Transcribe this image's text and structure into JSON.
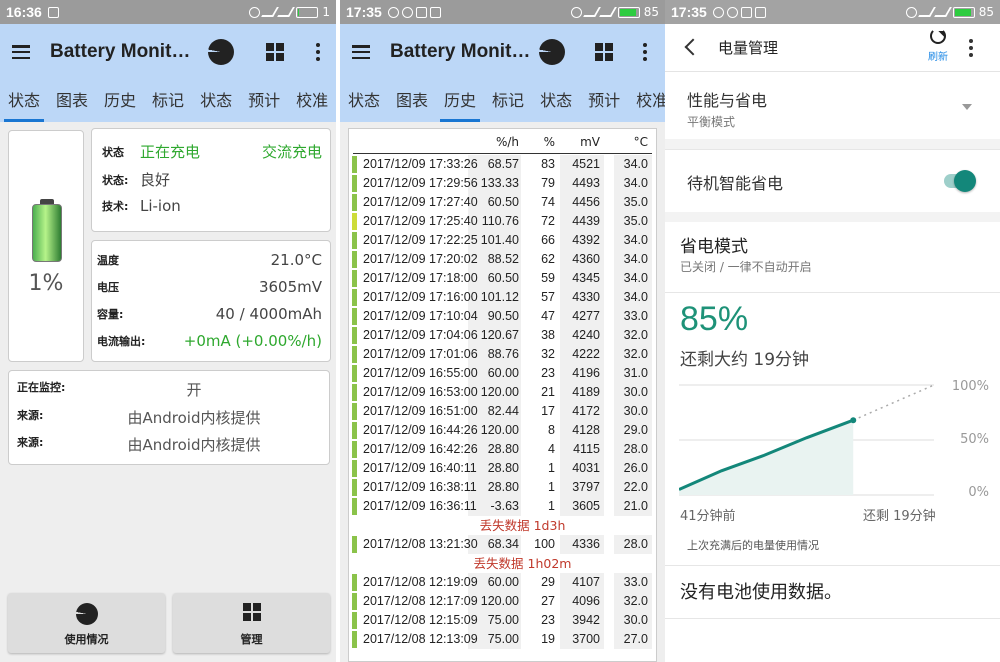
{
  "screen1": {
    "statusbar": {
      "time": "16:36",
      "battery_pct": "1"
    },
    "app_title": "Battery Monit…",
    "tabs": [
      "状态",
      "图表",
      "历史",
      "标记",
      "状态",
      "预计",
      "校准"
    ],
    "battery_pct": "1%",
    "status_card": {
      "status_label": "状态",
      "status_value": "正在充电",
      "charge_type": "交流充电",
      "health_label": "状态:",
      "health_value": "良好",
      "tech_label": "技术:",
      "tech_value": "Li-ion"
    },
    "detail_card": {
      "temp_label": "温度",
      "temp_value": "21.0°C",
      "voltage_label": "电压",
      "voltage_value": "3605mV",
      "capacity_label": "容量:",
      "capacity_value": "40 / 4000mAh",
      "current_label": "电流输出:",
      "current_value": "+0mA (+0.00%/h)"
    },
    "monitor_card": {
      "monitoring_label": "正在监控:",
      "monitoring_value": "开",
      "source1_label": "来源:",
      "source1_value": "由Android内核提供",
      "source2_label": "来源:",
      "source2_value": "由Android内核提供"
    },
    "buttons": {
      "usage": "使用情况",
      "manage": "管理"
    }
  },
  "screen2": {
    "statusbar": {
      "time": "17:35",
      "battery_pct": "85"
    },
    "app_title": "Battery Monit…",
    "tabs": [
      "状态",
      "图表",
      "历史",
      "标记",
      "状态",
      "预计",
      "校准"
    ],
    "headers": [
      "%/h",
      "%",
      "mV",
      "°C"
    ],
    "rows_a": [
      {
        "date": "2017/12/09 17:33:26",
        "rate": "68.57",
        "pct": "83",
        "mv": "4521",
        "temp": "34.0",
        "bar": "#8bc34a"
      },
      {
        "date": "2017/12/09 17:29:56",
        "rate": "133.33",
        "pct": "79",
        "mv": "4493",
        "temp": "34.0",
        "bar": "#8bc34a"
      },
      {
        "date": "2017/12/09 17:27:40",
        "rate": "60.50",
        "pct": "74",
        "mv": "4456",
        "temp": "35.0",
        "bar": "#8bc34a"
      },
      {
        "date": "2017/12/09 17:25:40",
        "rate": "110.76",
        "pct": "72",
        "mv": "4439",
        "temp": "35.0",
        "bar": "#cddc39"
      },
      {
        "date": "2017/12/09 17:22:25",
        "rate": "101.40",
        "pct": "66",
        "mv": "4392",
        "temp": "34.0",
        "bar": "#8bc34a"
      },
      {
        "date": "2017/12/09 17:20:02",
        "rate": "88.52",
        "pct": "62",
        "mv": "4360",
        "temp": "34.0",
        "bar": "#8bc34a"
      },
      {
        "date": "2017/12/09 17:18:00",
        "rate": "60.50",
        "pct": "59",
        "mv": "4345",
        "temp": "34.0",
        "bar": "#8bc34a"
      },
      {
        "date": "2017/12/09 17:16:00",
        "rate": "101.12",
        "pct": "57",
        "mv": "4330",
        "temp": "34.0",
        "bar": "#8bc34a"
      },
      {
        "date": "2017/12/09 17:10:04",
        "rate": "90.50",
        "pct": "47",
        "mv": "4277",
        "temp": "33.0",
        "bar": "#8bc34a"
      },
      {
        "date": "2017/12/09 17:04:06",
        "rate": "120.67",
        "pct": "38",
        "mv": "4240",
        "temp": "32.0",
        "bar": "#8bc34a"
      },
      {
        "date": "2017/12/09 17:01:06",
        "rate": "88.76",
        "pct": "32",
        "mv": "4222",
        "temp": "32.0",
        "bar": "#8bc34a"
      },
      {
        "date": "2017/12/09 16:55:00",
        "rate": "60.00",
        "pct": "23",
        "mv": "4196",
        "temp": "31.0",
        "bar": "#8bc34a"
      },
      {
        "date": "2017/12/09 16:53:00",
        "rate": "120.00",
        "pct": "21",
        "mv": "4189",
        "temp": "30.0",
        "bar": "#8bc34a"
      },
      {
        "date": "2017/12/09 16:51:00",
        "rate": "82.44",
        "pct": "17",
        "mv": "4172",
        "temp": "30.0",
        "bar": "#8bc34a"
      },
      {
        "date": "2017/12/09 16:44:26",
        "rate": "120.00",
        "pct": "8",
        "mv": "4128",
        "temp": "29.0",
        "bar": "#8bc34a"
      },
      {
        "date": "2017/12/09 16:42:26",
        "rate": "28.80",
        "pct": "4",
        "mv": "4115",
        "temp": "28.0",
        "bar": "#8bc34a"
      },
      {
        "date": "2017/12/09 16:40:11",
        "rate": "28.80",
        "pct": "1",
        "mv": "4031",
        "temp": "26.0",
        "bar": "#8bc34a"
      },
      {
        "date": "2017/12/09 16:38:11",
        "rate": "28.80",
        "pct": "1",
        "mv": "3797",
        "temp": "22.0",
        "bar": "#8bc34a"
      },
      {
        "date": "2017/12/09 16:36:11",
        "rate": "-3.63",
        "pct": "1",
        "mv": "3605",
        "temp": "21.0",
        "bar": "#8bc34a"
      }
    ],
    "lost1": "丢失数据 1d3h",
    "rows_b": [
      {
        "date": "2017/12/08 13:21:30",
        "rate": "68.34",
        "pct": "100",
        "mv": "4336",
        "temp": "28.0",
        "bar": "#8bc34a"
      }
    ],
    "lost2": "丢失数据 1h02m",
    "rows_c": [
      {
        "date": "2017/12/08 12:19:09",
        "rate": "60.00",
        "pct": "29",
        "mv": "4107",
        "temp": "33.0",
        "bar": "#8bc34a"
      },
      {
        "date": "2017/12/08 12:17:09",
        "rate": "120.00",
        "pct": "27",
        "mv": "4096",
        "temp": "32.0",
        "bar": "#8bc34a"
      },
      {
        "date": "2017/12/08 12:15:09",
        "rate": "75.00",
        "pct": "23",
        "mv": "3942",
        "temp": "30.0",
        "bar": "#8bc34a"
      },
      {
        "date": "2017/12/08 12:13:09",
        "rate": "75.00",
        "pct": "19",
        "mv": "3700",
        "temp": "27.0",
        "bar": "#8bc34a"
      }
    ]
  },
  "screen3": {
    "statusbar": {
      "time": "17:35",
      "battery_pct": "85"
    },
    "title": "电量管理",
    "refresh_label": "刷新",
    "perf_title": "性能与省电",
    "perf_sub": "平衡模式",
    "standby_title": "待机智能省电",
    "saver_title": "省电模式",
    "saver_sub": "已关闭 / 一律不自动开启",
    "percent": "85%",
    "remaining": "还剩大约 19分钟",
    "chart_x_left": "41分钟前",
    "chart_x_right": "还剩 19分钟",
    "chart_y": [
      "100%",
      "50%",
      "0%"
    ],
    "note": "上次充满后的电量使用情况",
    "no_data": "没有电池使用数据。"
  },
  "colors": {
    "appbar": "#bcd7f7",
    "accent_blue": "#1976d2",
    "green_text": "#2ea82e",
    "lost_red": "#c0392b",
    "teal": "#13877a"
  },
  "chart_data": {
    "type": "area",
    "title": "",
    "xlabel": "",
    "ylabel": "",
    "x_labels": [
      "41分钟前",
      "还剩 19分钟"
    ],
    "ylim": [
      0,
      100
    ],
    "series": [
      {
        "values": [
          [
            0,
            5
          ],
          [
            10,
            22
          ],
          [
            20,
            36
          ],
          [
            30,
            52
          ],
          [
            41,
            68
          ]
        ]
      },
      {
        "values": [
          [
            41,
            68
          ],
          [
            60,
            100
          ]
        ]
      }
    ]
  }
}
